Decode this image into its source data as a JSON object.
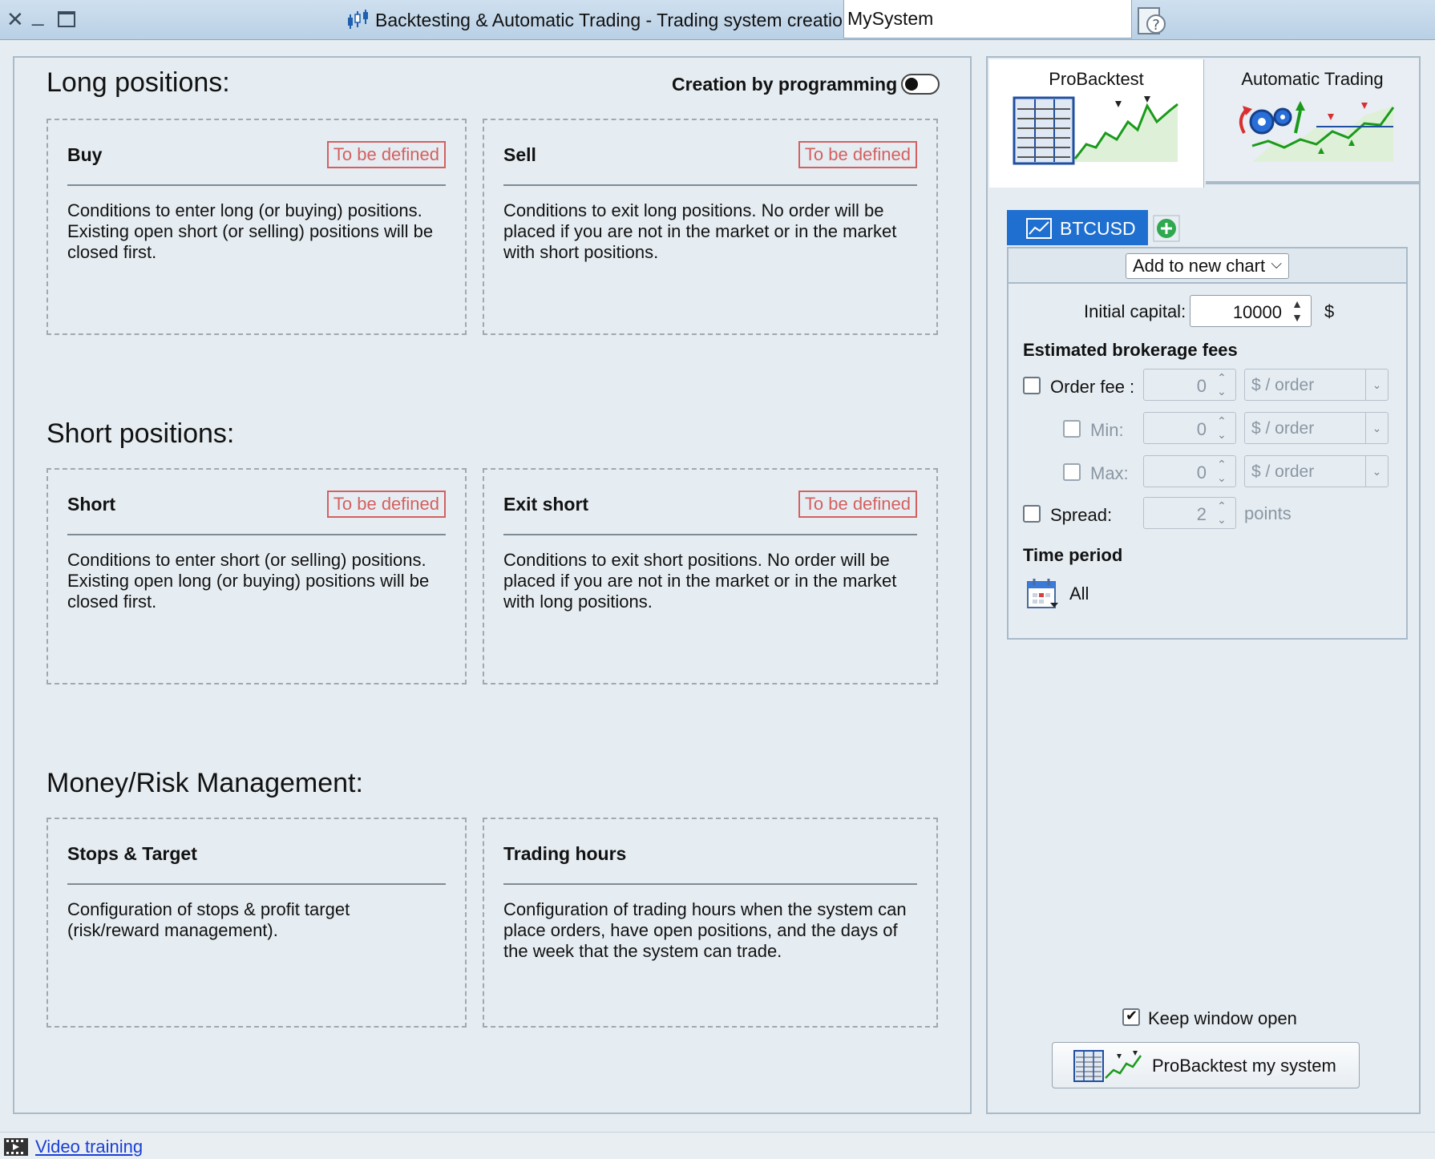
{
  "window": {
    "title": "Backtesting & Automatic Trading - Trading system creation",
    "system_name": "MySystem"
  },
  "long": {
    "heading": "Long positions:",
    "programming_label": "Creation by programming",
    "buy": {
      "title": "Buy",
      "status": "To be defined",
      "description": "Conditions to enter long (or buying) positions. Existing open short (or selling) positions will be closed first."
    },
    "sell": {
      "title": "Sell",
      "status": "To be defined",
      "description": "Conditions to exit long positions.  No order will be placed if you are not in the market or in the market with short positions."
    }
  },
  "short": {
    "heading": "Short positions:",
    "short": {
      "title": "Short",
      "status": "To be defined",
      "description": "Conditions to enter short (or selling) positions. Existing open long (or buying) positions will be closed first."
    },
    "exit_short": {
      "title": "Exit short",
      "status": "To be defined",
      "description": "Conditions to exit short positions.  No order will be placed if you are not in the market or in the market with long positions."
    }
  },
  "money": {
    "heading": "Money/Risk Management:",
    "stops": {
      "title": "Stops & Target",
      "description": "Configuration of stops & profit target (risk/reward management)."
    },
    "hours": {
      "title": "Trading hours",
      "description": "Configuration of trading hours when the system can place orders, have open positions, and the days of the week that the system can trade."
    }
  },
  "mode_tabs": {
    "probacktest": "ProBacktest",
    "automatic": "Automatic Trading"
  },
  "instrument": {
    "tab_label": "BTCUSD",
    "chart_option": "Add to new chart"
  },
  "capital": {
    "label": "Initial capital:",
    "value": "10000",
    "currency": "$"
  },
  "fees": {
    "heading": "Estimated brokerage fees",
    "order_fee": {
      "label": "Order fee :",
      "value": "0",
      "unit": "$ / order"
    },
    "min": {
      "label": "Min:",
      "value": "0",
      "unit": "$ / order"
    },
    "max": {
      "label": "Max:",
      "value": "0",
      "unit": "$ / order"
    },
    "spread": {
      "label": "Spread:",
      "value": "2",
      "unit": "points"
    }
  },
  "time_period": {
    "heading": "Time period",
    "value": "All"
  },
  "footer": {
    "keep_open_label": "Keep window open",
    "run_label": "ProBacktest my system"
  },
  "status": {
    "video_link": "Video training"
  }
}
